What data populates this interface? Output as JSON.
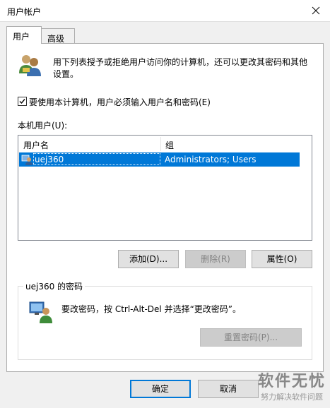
{
  "window": {
    "title": "用户帐户"
  },
  "tabs": [
    {
      "label": "用户"
    },
    {
      "label": "高级"
    }
  ],
  "intro": {
    "line1": "用下列表授予或拒绝用户访问你的计算机，还可以更改其密码和其他",
    "line2": "设置。"
  },
  "require_login": {
    "label": "要使用本计算机，用户必须输入用户名和密码(E)",
    "checked": true
  },
  "users_section": {
    "label": "本机用户(U):"
  },
  "users_table": {
    "columns": [
      "用户名",
      "组"
    ],
    "rows": [
      {
        "name": "uej360",
        "group": "Administrators; Users",
        "selected": true
      }
    ]
  },
  "buttons": {
    "add": "添加(D)...",
    "remove": "删除(R)",
    "properties": "属性(O)"
  },
  "password_group": {
    "title": "uej360 的密码",
    "hint": "要改密码，按 Ctrl-Alt-Del 并选择“更改密码”。",
    "reset_button": "重置密码(P)..."
  },
  "footer": {
    "ok": "确定",
    "cancel": "取消"
  },
  "watermark": {
    "brand": "软件无忧",
    "tagline": "努力解决软件问题"
  },
  "colors": {
    "selection": "#0078d7",
    "window_bg": "#f0f0f0"
  }
}
